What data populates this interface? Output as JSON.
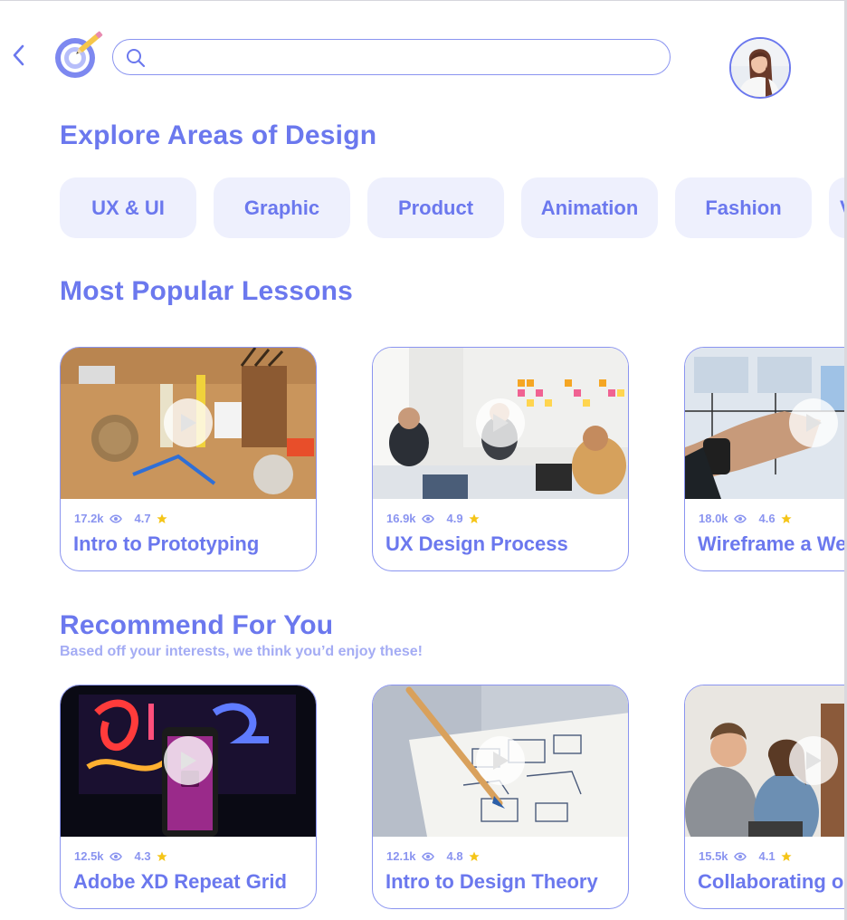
{
  "header": {
    "search_placeholder": "",
    "search_value": ""
  },
  "sections": {
    "explore_title": "Explore Areas of Design",
    "popular_title": "Most Popular Lessons",
    "recommend_title": "Recommend For You",
    "recommend_subtitle": "Based off your interests, we think you’d enjoy these!"
  },
  "categories": [
    "UX & UI",
    "Graphic",
    "Product",
    "Animation",
    "Fashion",
    "V"
  ],
  "popular_lessons": [
    {
      "views": "17.2k",
      "rating": "4.7",
      "title": "Intro to Prototyping"
    },
    {
      "views": "16.9k",
      "rating": "4.9",
      "title": "UX Design Process"
    },
    {
      "views": "18.0k",
      "rating": "4.6",
      "title": "Wireframe a Website"
    }
  ],
  "recommended": [
    {
      "views": "12.5k",
      "rating": "4.3",
      "title": "Adobe XD Repeat Grid"
    },
    {
      "views": "12.1k",
      "rating": "4.8",
      "title": "Intro to Design Theory"
    },
    {
      "views": "15.5k",
      "rating": "4.1",
      "title": "Collaborating on Designs"
    }
  ],
  "colors": {
    "accent": "#6b78ee",
    "chip_bg": "#eef0fd",
    "star": "#f5c518"
  },
  "icons": {
    "back": "chevron-left-icon",
    "search": "search-icon",
    "views": "eye-icon",
    "rating": "star-icon",
    "play": "play-icon",
    "logo": "target-pencil-logo"
  }
}
